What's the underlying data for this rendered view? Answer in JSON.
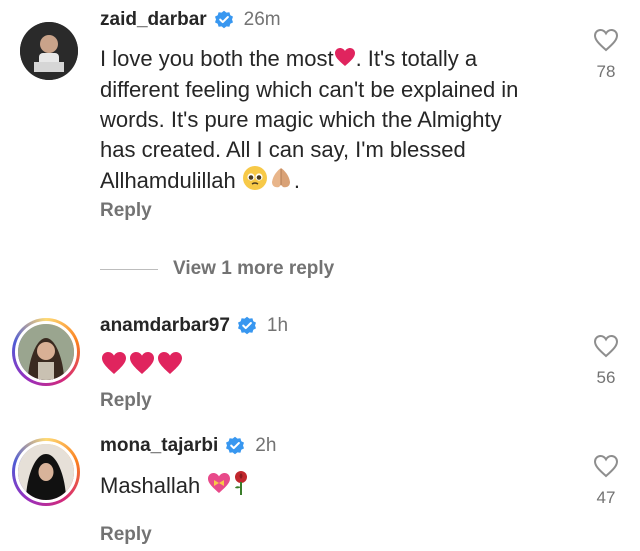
{
  "comments": [
    {
      "username": "zaid_darbar",
      "time": "26m",
      "text_lines": [
        "I love you both the most",
        ". It's totally a",
        "different feeling which can't be explained in",
        "words. It's pure magic which the Almighty",
        "has created. All I can say, I'm blessed",
        "Allhamdulillah",
        "."
      ],
      "reply_label": "Reply",
      "likes": "78"
    },
    {
      "username": "anamdarbar97",
      "time": "1h",
      "reply_label": "Reply",
      "likes": "56"
    },
    {
      "username": "mona_tajarbi",
      "time": "2h",
      "text": "Mashallah",
      "reply_label": "Reply",
      "likes": "47"
    }
  ],
  "view_more_replies": "View 1 more reply",
  "colors": {
    "verified": "#3897f0",
    "heart_emoji": "#e0245e",
    "secondary_text": "#737373"
  }
}
